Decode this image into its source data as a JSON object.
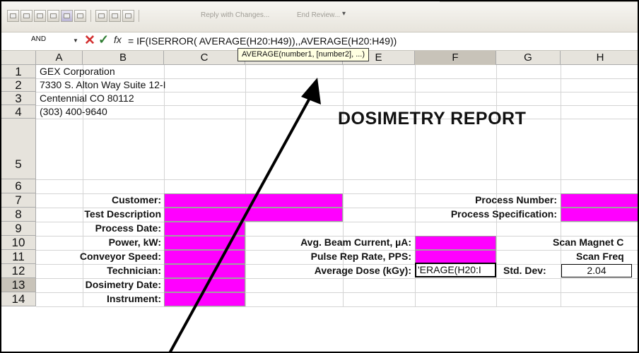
{
  "toolbar": {
    "reply_label": "Reply with Changes...",
    "end_review_label": "End Review..."
  },
  "formula_bar": {
    "name_box": "AND",
    "formula": "= IF(ISERROR( AVERAGE(H20:H49)),,AVERAGE(H20:H49))",
    "tooltip": "AVERAGE(number1, [number2], ...)"
  },
  "columns": [
    "A",
    "B",
    "C",
    "D",
    "E",
    "F",
    "G",
    "H"
  ],
  "rows": [
    "1",
    "2",
    "3",
    "4",
    "5",
    "6",
    "7",
    "8",
    "9",
    "10",
    "11",
    "12",
    "13",
    "14"
  ],
  "company": {
    "name": "GEX Corporation",
    "address1": "7330 S. Alton Way Suite 12-I",
    "address2": "Centennial CO 80112",
    "phone": "(303) 400-9640"
  },
  "report_title": "DOSIMETRY REPORT",
  "labels": {
    "customer": "Customer:",
    "test_description": "Test Description",
    "process_date": "Process Date:",
    "power": "Power, kW:",
    "conveyor_speed": "Conveyor Speed:",
    "technician": "Technician:",
    "dosimetry_date": "Dosimetry Date:",
    "instrument": "Instrument:",
    "process_number": "Process Number:",
    "process_specification": "Process Specification:",
    "beam_current": "Avg. Beam Current, µA:",
    "pulse_rate": "Pulse Rep Rate, PPS:",
    "average_dose": "Average Dose (kGy):",
    "std_dev": "Std. Dev:",
    "scan_magnet": "Scan Magnet C",
    "scan_freq": "Scan Freq"
  },
  "values": {
    "editing_cell": "'ERAGE(H20:I",
    "std_dev": "2.04"
  },
  "colors": {
    "input_fill": "#ff00ff",
    "header_bg": "#e6e3dc",
    "tooltip_bg": "#ffffe1",
    "cancel_icon": "#d32f2f",
    "enter_icon": "#2e7d32"
  }
}
